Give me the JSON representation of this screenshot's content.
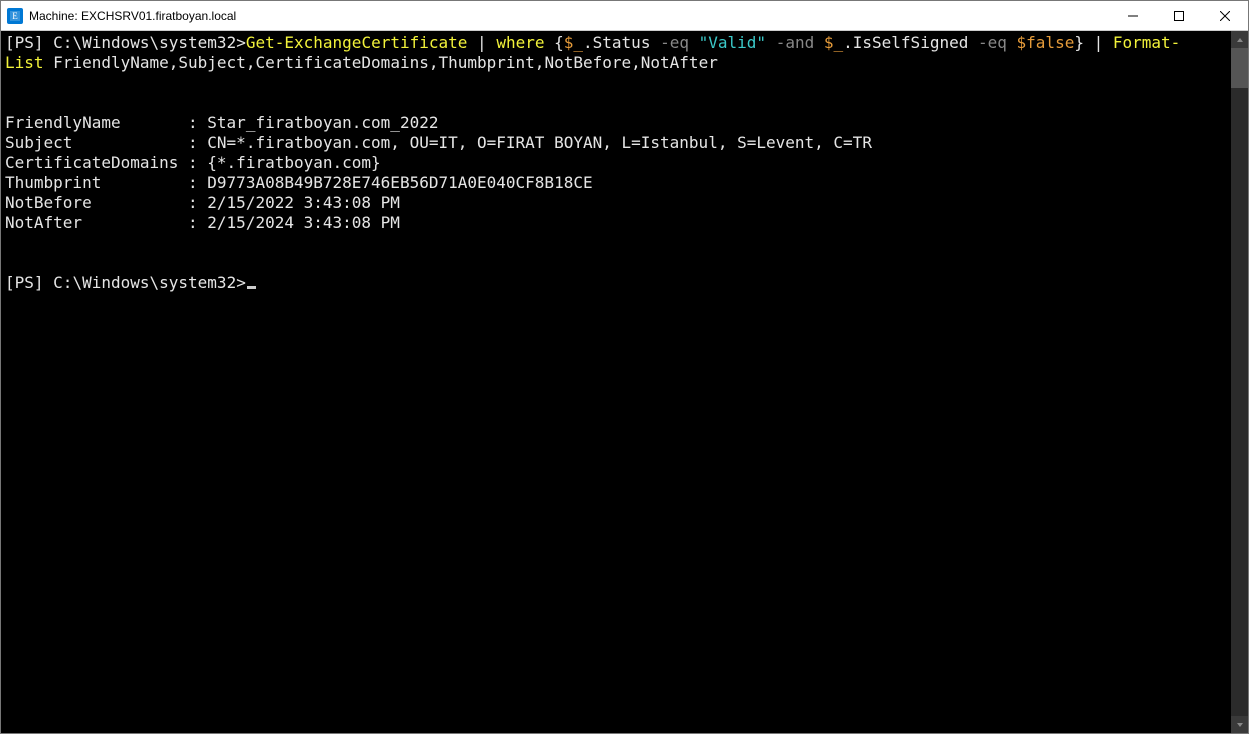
{
  "titlebar": {
    "title": "Machine: EXCHSRV01.firatboyan.local"
  },
  "prompt": {
    "ps": "[PS]",
    "path": "C:\\Windows\\system32",
    "gt": ">"
  },
  "cmd": {
    "get": "Get-ExchangeCertificate",
    "pipe1": " | ",
    "where": "where",
    "brace_open": " {",
    "dvar1": "$_",
    "dot_status": ".Status ",
    "eq1": "-eq",
    "valid": " \"Valid\" ",
    "and": "-and",
    "sp1": " ",
    "dvar2": "$_",
    "dot_iss": ".IsSelfSigned ",
    "eq2": "-eq",
    "sp2": " ",
    "false": "$false",
    "brace_close": "}",
    "pipe2": " | ",
    "format": "Format-",
    "list": "List",
    "fields": " FriendlyName,Subject,CertificateDomains,Thumbprint,NotBefore,NotAfter"
  },
  "output": {
    "props": [
      {
        "name": "FriendlyName",
        "value": "Star_firatboyan.com_2022"
      },
      {
        "name": "Subject",
        "value": "CN=*.firatboyan.com, OU=IT, O=FIRAT BOYAN, L=Istanbul, S=Levent, C=TR"
      },
      {
        "name": "CertificateDomains",
        "value": "{*.firatboyan.com}"
      },
      {
        "name": "Thumbprint",
        "value": "D9773A08B49B728E746EB56D71A0E040CF8B18CE"
      },
      {
        "name": "NotBefore",
        "value": "2/15/2022 3:43:08 PM"
      },
      {
        "name": "NotAfter",
        "value": "2/15/2024 3:43:08 PM"
      }
    ]
  }
}
